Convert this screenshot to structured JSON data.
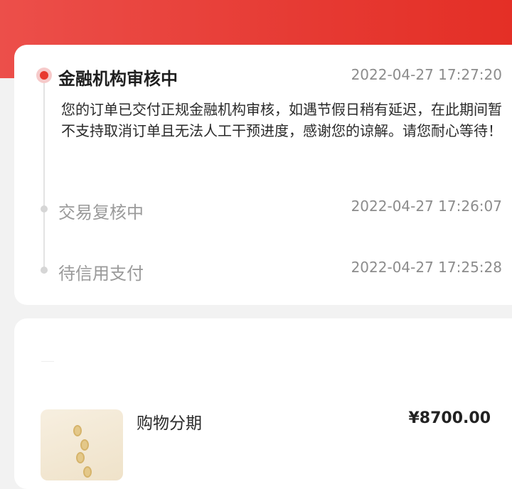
{
  "timeline": {
    "steps": [
      {
        "title": "金融机构审核中",
        "time": "2022-04-27 17:27:20",
        "desc": "您的订单已交付正规金融机构审核，如遇节假日稍有延迟，在此期间暂不支持取消订单且无法人工干预进度，感谢您的谅解。请您耐心等待！",
        "state": "active"
      },
      {
        "title": "交易复核中",
        "time": "2022-04-27 17:26:07",
        "state": "done"
      },
      {
        "title": "待信用支付",
        "time": "2022-04-27 17:25:28",
        "state": "done"
      }
    ]
  },
  "product": {
    "name": "购物分期",
    "price": "¥8700.00",
    "thumbnail_icon": "coin-stack-icon"
  },
  "colors": {
    "header_red": "#e63a33",
    "active_dot": "#e8392f",
    "inactive_dot": "#d6d6d6",
    "page_background": "#f2f2f2"
  }
}
